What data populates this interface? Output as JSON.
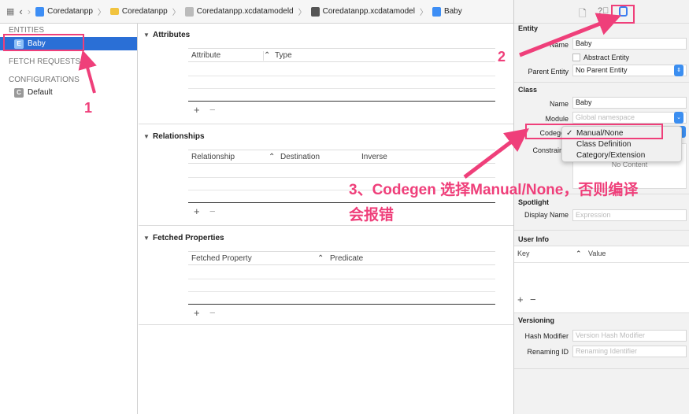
{
  "breadcrumb": [
    {
      "label": "Coredatanpp",
      "icon": "project-icon",
      "color": "#3d8ef5"
    },
    {
      "label": "Coredatanpp",
      "icon": "folder-icon",
      "color": "#f1c33f"
    },
    {
      "label": "Coredatanpp.xcdatamodeld",
      "icon": "datamodel-bundle-icon",
      "color": "#aaaaaa"
    },
    {
      "label": "Coredatanpp.xcdatamodel",
      "icon": "datamodel-icon",
      "color": "#555555"
    },
    {
      "label": "Baby",
      "icon": "entity-icon",
      "color": "#3d8ef5"
    }
  ],
  "sidebar": {
    "entities_header": "ENTITIES",
    "entity": {
      "badge": "E",
      "label": "Baby"
    },
    "fetch_header": "FETCH REQUESTS",
    "config_header": "CONFIGURATIONS",
    "config": {
      "badge": "C",
      "label": "Default"
    },
    "selection_color": "#2a6fd6"
  },
  "main": {
    "attributes": {
      "title": "Attributes",
      "cols": [
        "Attribute",
        "Type"
      ]
    },
    "relationships": {
      "title": "Relationships",
      "cols": [
        "Relationship",
        "Destination",
        "Inverse"
      ]
    },
    "fetched": {
      "title": "Fetched Properties",
      "cols": [
        "Fetched Property",
        "Predicate"
      ]
    },
    "add": "+",
    "remove": "−"
  },
  "inspector": {
    "entity": {
      "title": "Entity",
      "name_label": "Name",
      "name": "Baby",
      "abstract": "Abstract Entity",
      "parent_label": "Parent Entity",
      "parent": "No Parent Entity"
    },
    "class": {
      "title": "Class",
      "name_label": "Name",
      "name": "Baby",
      "module_label": "Module",
      "module_placeholder": "Global namespace",
      "codegen_label": "Codegen",
      "constraints_label": "Constraints",
      "constraints_value": "No Content"
    },
    "codegen_menu": {
      "options": [
        "Manual/None",
        "Class Definition",
        "Category/Extension"
      ],
      "selected": "Manual/None",
      "check": "✓"
    },
    "spotlight": {
      "title": "Spotlight",
      "display_label": "Display Name",
      "display_placeholder": "Expression"
    },
    "userinfo": {
      "title": "User Info",
      "cols": [
        "Key",
        "Value"
      ]
    },
    "versioning": {
      "title": "Versioning",
      "hash_label": "Hash Modifier",
      "hash_placeholder": "Version Hash Modifier",
      "renaming_label": "Renaming ID",
      "renaming_placeholder": "Renaming Identifier"
    }
  },
  "annotations": {
    "one": "1",
    "two": "2",
    "three_line1": "3、Codegen 选择Manual/None，否则编译",
    "three_line2": "会报错",
    "color": "#ef3f7a"
  }
}
